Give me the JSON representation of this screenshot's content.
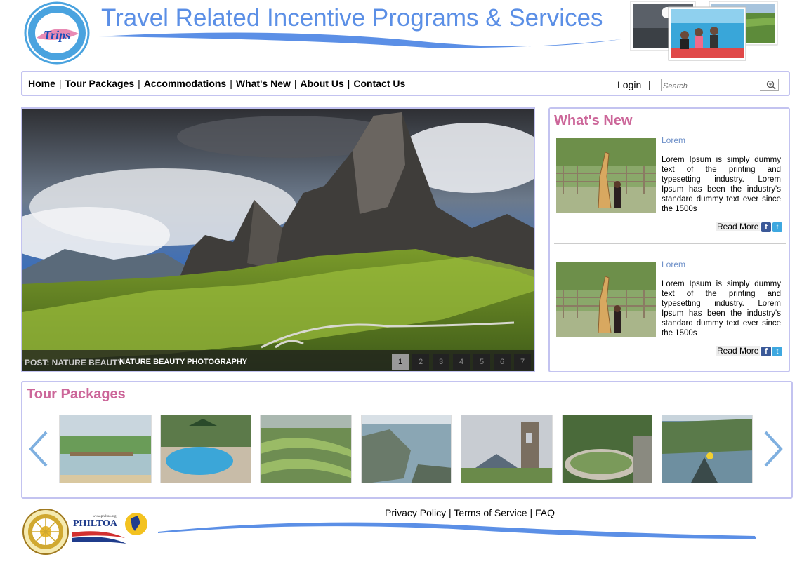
{
  "header": {
    "title": "Travel Related Incentive Programs & Services",
    "logo_text": "Trips",
    "logo_ring_text": "TRAVEL RELATED INCENTIVE PROGRAMMES & SERVICES INC."
  },
  "nav": {
    "items": [
      "Home",
      "Tour Packages",
      "Accommodations",
      "What's New",
      "About Us",
      "Contact Us"
    ],
    "separator": "|",
    "login": "Login",
    "login_separator": "|",
    "search_placeholder": "Search"
  },
  "hero": {
    "caption_label": "POST: NATURE BEAUTY",
    "caption_text": "NATURE BEAUTY PHOTOGRAPHY",
    "pages": [
      "1",
      "2",
      "3",
      "4",
      "5",
      "6",
      "7"
    ],
    "active_page": "1"
  },
  "whats_new": {
    "title": "What's New",
    "items": [
      {
        "heading": "Lorem",
        "body": "Lorem Ipsum is simply dummy text of the printing and typesetting industry. Lorem Ipsum has been the industry's standard dummy text ever since the 1500s",
        "read_more": "Read More"
      },
      {
        "heading": "Lorem",
        "body": "Lorem Ipsum is simply dummy text of the printing and typesetting industry. Lorem Ipsum has been the industry's standard dummy text ever since the 1500s",
        "read_more": "Read More"
      }
    ],
    "facebook_icon": "f",
    "twitter_icon": "t"
  },
  "tours": {
    "title": "Tour Packages"
  },
  "footer": {
    "links": [
      "Privacy Policy",
      "Terms of Service",
      "FAQ"
    ],
    "separator": "|",
    "philtoa_text": "PHILTOA",
    "philtoa_url": "www.philtoa.org",
    "dot_text": "DEPARTMENT OF TOURISM"
  },
  "colors": {
    "title_blue": "#5b8fe6",
    "accent_pink": "#cc6699",
    "border_lilac": "#c3c3f0",
    "link_blue": "#6f91c9"
  }
}
